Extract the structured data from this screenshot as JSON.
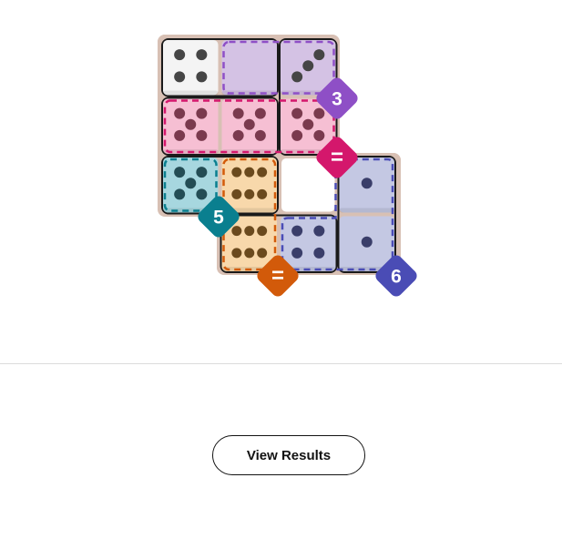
{
  "colors": {
    "board_bg": "#d8c0b4",
    "white_die": "#f4f4f4",
    "purple_light": "#d4c2e4",
    "purple_accent": "#8e4fc6",
    "pink_light": "#f6bfd3",
    "pink_accent": "#d4176c",
    "teal_light": "#a7d7df",
    "teal_accent": "#0a7f8f",
    "orange_light": "#f8d8ab",
    "orange_accent": "#d25a0a",
    "blue_light": "#c4c8e3",
    "blue_accent": "#4a4cb5",
    "pip_dark": "#454545",
    "pip_pink": "#7a3a4e",
    "pip_teal": "#244d55",
    "pip_brown": "#6b4a1e",
    "pip_navy": "#3a3e6a"
  },
  "dice": [
    {
      "row": 0,
      "col": 0,
      "pips": 4,
      "fill": "white"
    },
    {
      "row": 0,
      "col": 1,
      "pips": 0,
      "fill": "purple"
    },
    {
      "row": 0,
      "col": 2,
      "pips": 3,
      "fill": "purple"
    },
    {
      "row": 1,
      "col": 0,
      "pips": 5,
      "fill": "pink"
    },
    {
      "row": 1,
      "col": 1,
      "pips": 5,
      "fill": "pink"
    },
    {
      "row": 1,
      "col": 2,
      "pips": 5,
      "fill": "pink"
    },
    {
      "row": 2,
      "col": 0,
      "pips": 5,
      "fill": "teal"
    },
    {
      "row": 2,
      "col": 1,
      "pips": 6,
      "fill": "orange"
    },
    {
      "row": 2,
      "col": 3,
      "pips": 1,
      "fill": "blue"
    },
    {
      "row": 3,
      "col": 1,
      "pips": 6,
      "fill": "orange"
    },
    {
      "row": 3,
      "col": 2,
      "pips": 4,
      "fill": "blue"
    },
    {
      "row": 3,
      "col": 3,
      "pips": 1,
      "fill": "blue"
    }
  ],
  "badges": [
    {
      "label": "3",
      "color": "purple"
    },
    {
      "label": "=",
      "color": "pink"
    },
    {
      "label": "5",
      "color": "teal"
    },
    {
      "label": "=",
      "color": "orange"
    },
    {
      "label": "6",
      "color": "blue"
    }
  ],
  "view_results_label": "View Results"
}
